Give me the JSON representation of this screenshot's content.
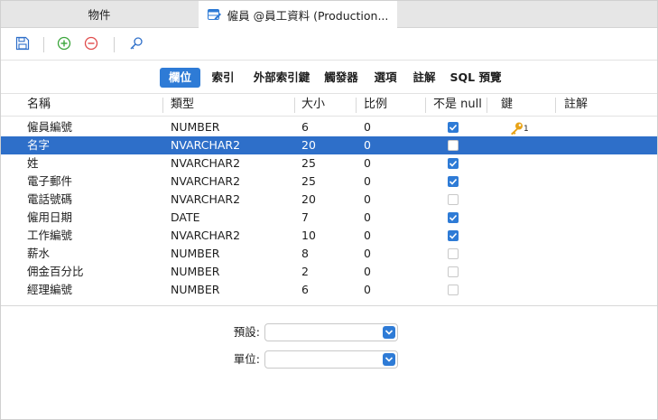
{
  "tabs": {
    "objects_label": "物件",
    "design_label": "僱員 @員工資料 (Production..."
  },
  "subtabs": [
    "欄位",
    "索引",
    "外部索引鍵",
    "觸發器",
    "選項",
    "註解",
    "SQL 預覽"
  ],
  "active_subtab": "欄位",
  "columns": {
    "name": "名稱",
    "type": "類型",
    "size": "大小",
    "scale": "比例",
    "not_null": "不是 null",
    "key": "鍵",
    "comment": "註解"
  },
  "rows": [
    {
      "name": "僱員編號",
      "type": "NUMBER",
      "size": "6",
      "scale": "0",
      "not_null": true,
      "key": "1"
    },
    {
      "name": "名字",
      "type": "NVARCHAR2",
      "size": "20",
      "scale": "0",
      "not_null": false,
      "key": ""
    },
    {
      "name": "姓",
      "type": "NVARCHAR2",
      "size": "25",
      "scale": "0",
      "not_null": true,
      "key": ""
    },
    {
      "name": "電子郵件",
      "type": "NVARCHAR2",
      "size": "25",
      "scale": "0",
      "not_null": true,
      "key": ""
    },
    {
      "name": "電話號碼",
      "type": "NVARCHAR2",
      "size": "20",
      "scale": "0",
      "not_null": false,
      "key": ""
    },
    {
      "name": "僱用日期",
      "type": "DATE",
      "size": "7",
      "scale": "0",
      "not_null": true,
      "key": ""
    },
    {
      "name": "工作編號",
      "type": "NVARCHAR2",
      "size": "10",
      "scale": "0",
      "not_null": true,
      "key": ""
    },
    {
      "name": "薪水",
      "type": "NUMBER",
      "size": "8",
      "scale": "0",
      "not_null": false,
      "key": ""
    },
    {
      "name": "佣金百分比",
      "type": "NUMBER",
      "size": "2",
      "scale": "0",
      "not_null": false,
      "key": ""
    },
    {
      "name": "經理編號",
      "type": "NUMBER",
      "size": "6",
      "scale": "0",
      "not_null": false,
      "key": ""
    }
  ],
  "selected_row": "名字",
  "form": {
    "default_label": "預設:",
    "default_value": "",
    "unit_label": "單位:",
    "unit_value": ""
  },
  "colors": {
    "accent": "#2e7bd6",
    "selection": "#2e6fc9",
    "add_icon": "#3aa53a",
    "remove_icon": "#e04b4b",
    "key_icon": "#e8a317"
  },
  "icons": {
    "table_tab": "table-design-icon",
    "save": "save-icon",
    "add": "add-field-icon",
    "remove": "remove-field-icon",
    "search": "search-key-icon",
    "primary_key": "primary-key-icon"
  }
}
